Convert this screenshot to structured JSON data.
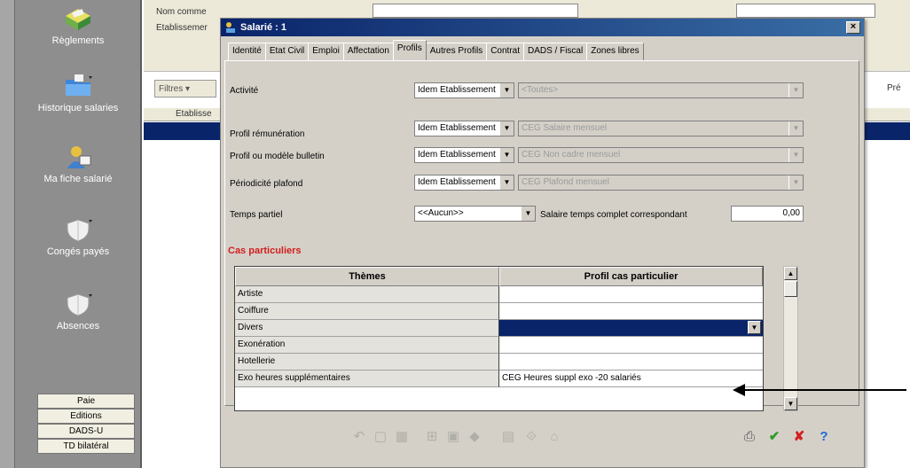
{
  "sidebar": {
    "items": [
      {
        "label": "Règlements",
        "icon": "payment-box-icon"
      },
      {
        "label": "Historique salaries",
        "icon": "folder-history-icon"
      },
      {
        "label": "Ma fiche salarié",
        "icon": "employee-card-icon"
      },
      {
        "label": "Congés payés",
        "icon": "leave-shield-icon"
      },
      {
        "label": "Absences",
        "icon": "absence-shield-icon"
      }
    ],
    "buttons": [
      "Paie",
      "Editions",
      "DADS-U",
      "TD bilatéral"
    ]
  },
  "background": {
    "field_label_1": "Nom comme",
    "field_label_2": "Etablissemer",
    "filter_label": "Filtres",
    "grid_header_1": "Etablisse",
    "right_label": "Pré"
  },
  "dialog": {
    "title": "Salarié : 1",
    "close_glyph": "×",
    "tabs": [
      {
        "label": "Identité",
        "active": false
      },
      {
        "label": "Etat Civil",
        "active": false
      },
      {
        "label": "Emploi",
        "active": false
      },
      {
        "label": "Affectation",
        "active": false
      },
      {
        "label": "Profils",
        "active": true
      },
      {
        "label": "Autres Profils",
        "active": false
      },
      {
        "label": "Contrat",
        "active": false
      },
      {
        "label": "DADS / Fiscal",
        "active": false
      },
      {
        "label": "Zones libres",
        "active": false
      }
    ],
    "rows": {
      "activite": {
        "label": "Activité",
        "mode": "Idem Etablissement",
        "value": "<Toutes>"
      },
      "profil_remuneration": {
        "label": "Profil rémunération",
        "mode": "Idem Etablissement",
        "value": "CEG  Salaire mensuel"
      },
      "profil_bulletin": {
        "label": "Profil ou modèle bulletin",
        "mode": "Idem Etablissement",
        "value": "CEG  Non cadre mensuel"
      },
      "periodicite": {
        "label": "Périodicité  plafond",
        "mode": "Idem Etablissement",
        "value": "CEG  Plafond mensuel"
      },
      "temps_partiel": {
        "label": "Temps partiel",
        "mode": "<<Aucun>>",
        "salaire_label": "Salaire temps complet correspondant",
        "salaire_value": "0,00"
      }
    },
    "section_title": "Cas particuliers",
    "grid": {
      "headers": [
        "Thèmes",
        "Profil cas particulier"
      ],
      "rows": [
        {
          "theme": "Artiste",
          "profil": ""
        },
        {
          "theme": "Coiffure",
          "profil": ""
        },
        {
          "theme": "Divers",
          "profil": ""
        },
        {
          "theme": "Exonération",
          "profil": ""
        },
        {
          "theme": "Hotellerie",
          "profil": ""
        },
        {
          "theme": "Exo heures supplémentaires",
          "profil": "CEG  Heures suppl exo -20 salariés"
        }
      ]
    },
    "toolbar": {
      "icons": [
        "undo-icon",
        "new-record-icon",
        "delete-icon",
        "tree-icon",
        "grid-icon",
        "search-icon",
        "calendar-icon",
        "link-icon",
        "home-icon",
        "print-icon",
        "confirm-icon",
        "cancel-icon",
        "help-icon"
      ],
      "confirm_glyph": "✔",
      "cancel_glyph": "✘",
      "help_glyph": "?"
    }
  },
  "colors": {
    "title_bar": "#0a246a",
    "section_title": "#d21e1e",
    "selection": "#0a246a",
    "confirm": "#2e9b2e",
    "cancel": "#d42020",
    "help": "#1e6ad4"
  }
}
